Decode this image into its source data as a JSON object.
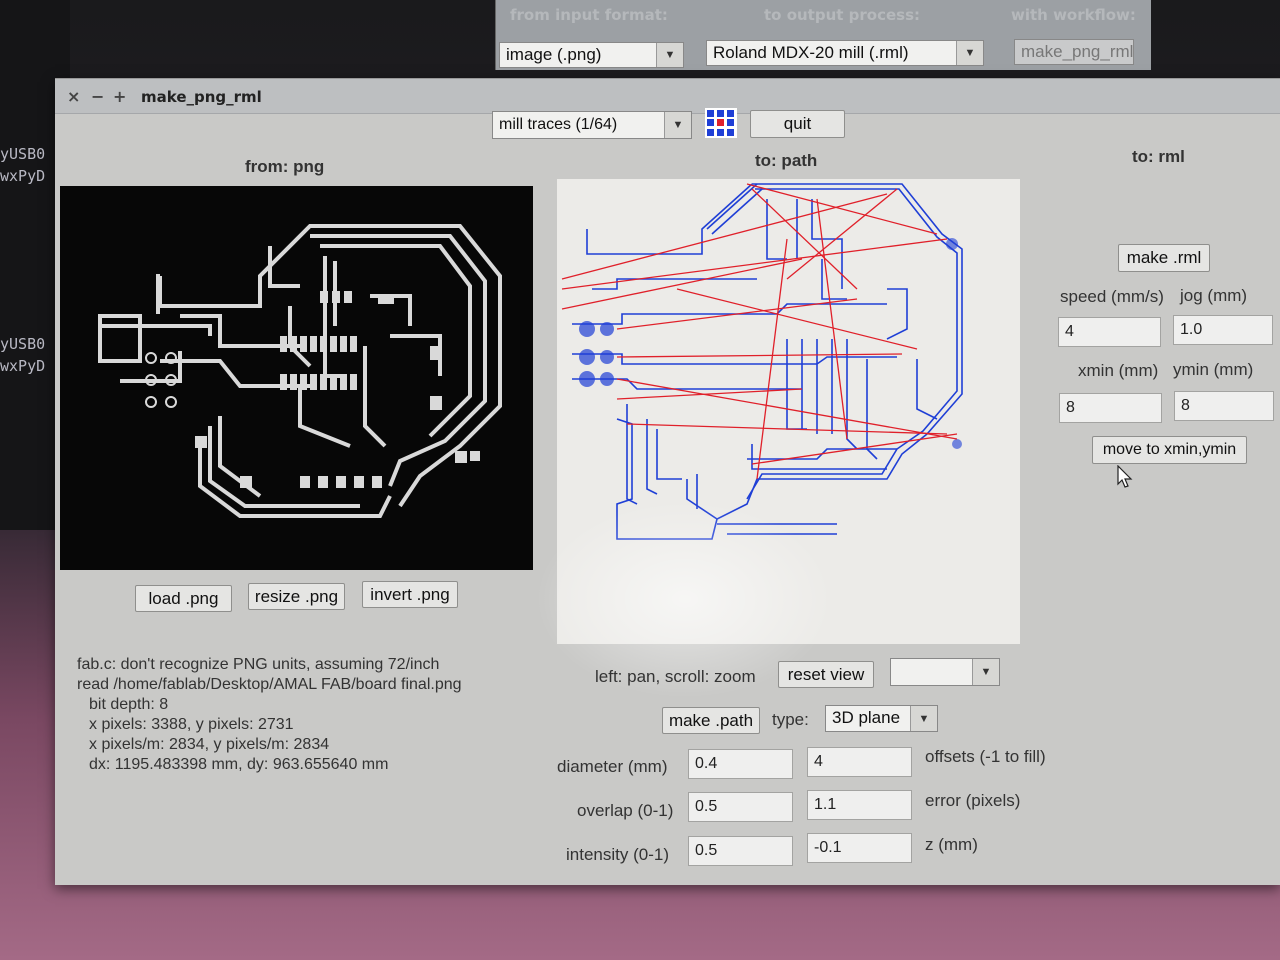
{
  "background": {
    "terminal_lines": [
      "yUSB0",
      "wxPyD",
      "yUSB0",
      "wxPyD"
    ],
    "launcher": {
      "from_label": "from input format:",
      "to_label": "to output process:",
      "workflow_label": "with workflow:",
      "input_format": "image (.png)",
      "output_process": "Roland MDX-20 mill (.rml)",
      "workflow": "make_png_rml"
    }
  },
  "window": {
    "title": "make_png_rml",
    "controls": [
      "×",
      "−",
      "+"
    ]
  },
  "toolbar": {
    "process": "mill traces (1/64)",
    "quit_label": "quit"
  },
  "headers": {
    "from": "from: png",
    "to_path": "to: path",
    "to_rml": "to: rml"
  },
  "png_buttons": {
    "load": "load .png",
    "resize": "resize .png",
    "invert": "invert .png"
  },
  "info_lines": [
    "fab.c: don't recognize PNG units, assuming 72/inch",
    "read /home/fablab/Desktop/AMAL FAB/board final.png",
    "bit depth: 8",
    "x pixels: 3388, y pixels: 2731",
    "x pixels/m: 2834, y pixels/m: 2834",
    "dx: 1195.483398 mm, dy: 963.655640 mm"
  ],
  "path_controls": {
    "hint": "left: pan, scroll: zoom",
    "reset_view": "reset view",
    "view_select": "",
    "make_path": "make .path",
    "type_label": "type:",
    "type_value": "3D plane",
    "diameter_label": "diameter (mm)",
    "diameter": "0.4",
    "offsets": "4",
    "offsets_label": "offsets (-1 to fill)",
    "overlap_label": "overlap (0-1)",
    "overlap": "0.5",
    "error": "1.1",
    "error_label": "error (pixels)",
    "intensity_label": "intensity (0-1)",
    "intensity": "0.5",
    "z": "-0.1",
    "z_label": "z (mm)"
  },
  "rml_controls": {
    "make_rml": "make .rml",
    "speed_label": "speed (mm/s)",
    "jog_label": "jog (mm)",
    "speed": "4",
    "jog": "1.0",
    "xmin_label": "xmin (mm)",
    "ymin_label": "ymin (mm)",
    "xmin": "8",
    "ymin": "8",
    "move_button": "move to xmin,ymin"
  },
  "colors": {
    "path_blue": "#1f3fd6",
    "path_red": "#e0202a",
    "pcb_trace": "#d9d9d9",
    "pcb_background": "#070707"
  },
  "icons": {
    "palette": "palette-grid-icon",
    "cursor": "mouse-pointer-icon"
  }
}
